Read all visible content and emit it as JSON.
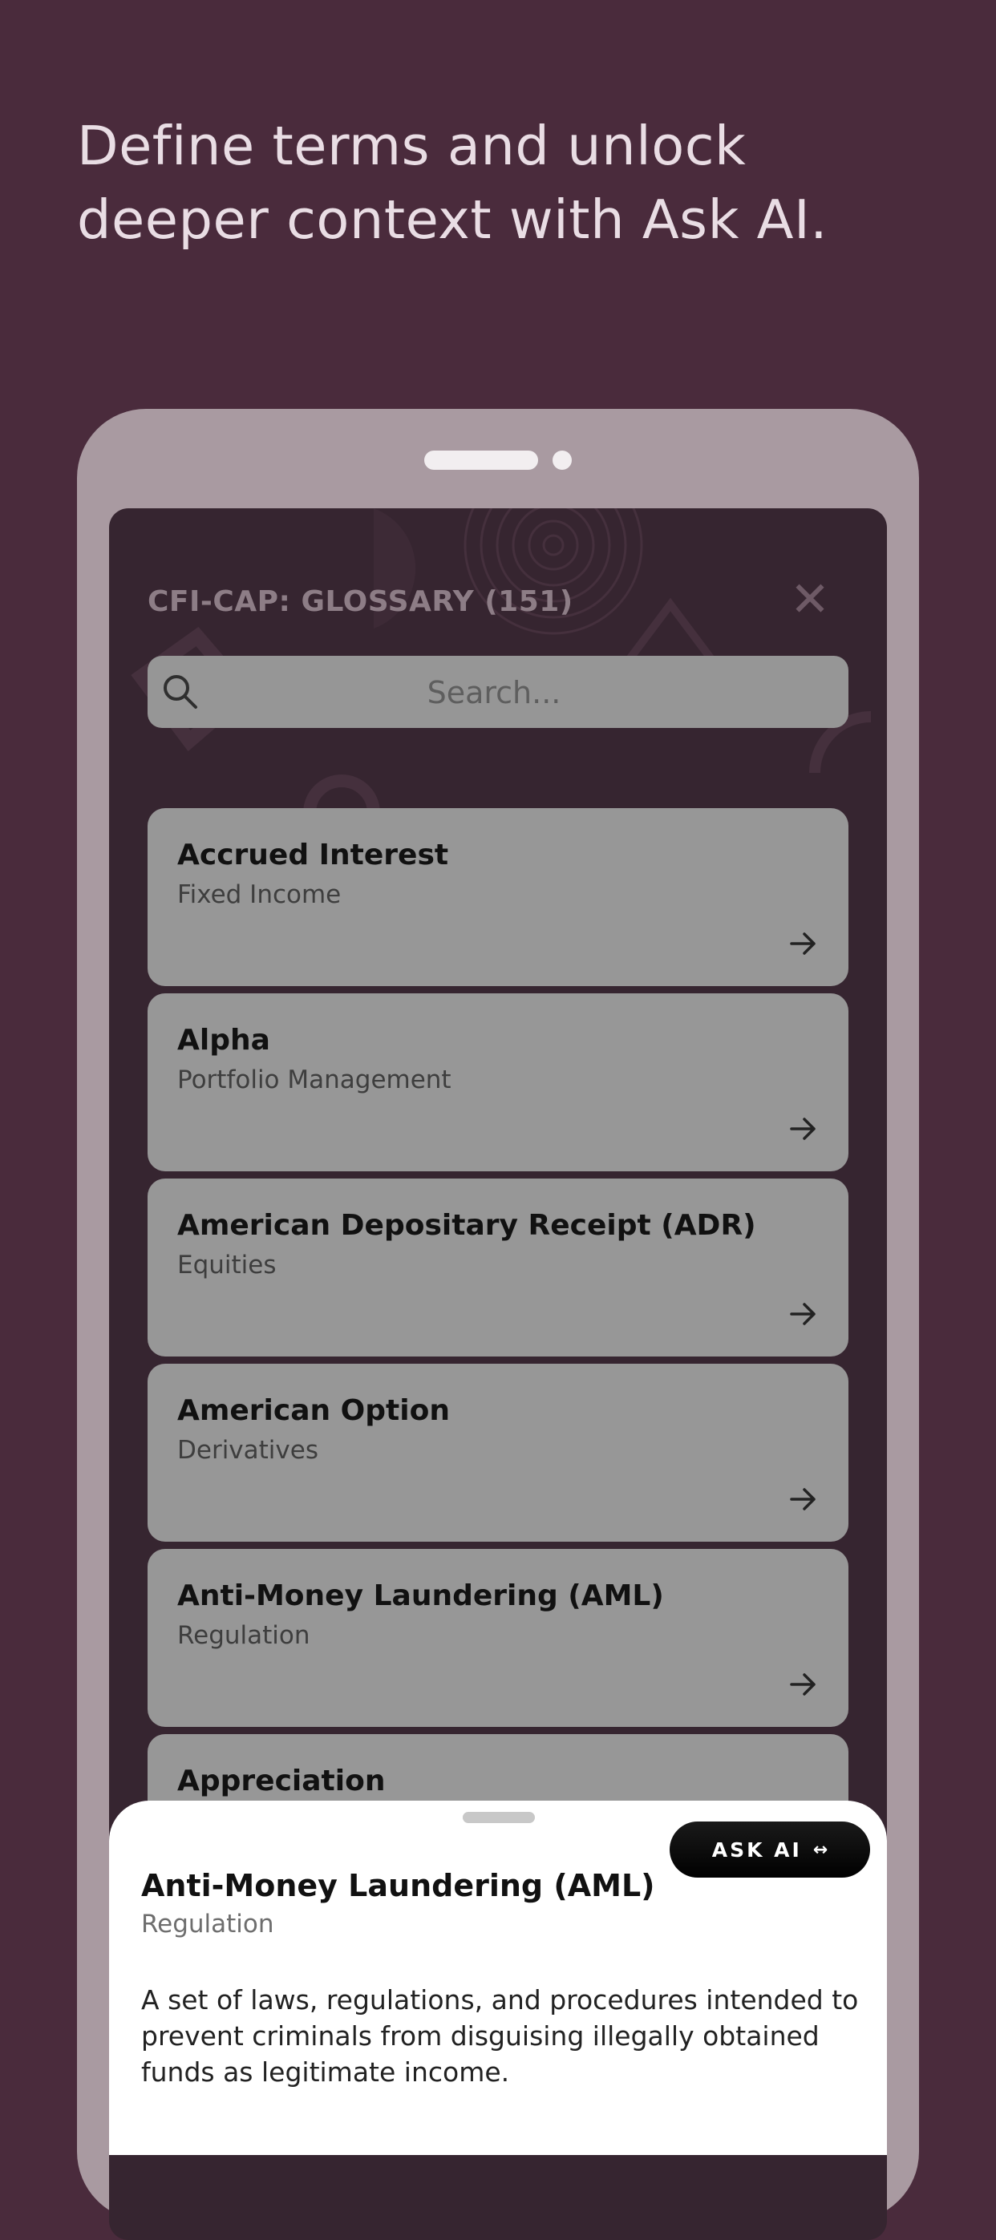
{
  "headline": {
    "line1": "Define terms and unlock",
    "line2": "deeper context with Ask AI."
  },
  "screen": {
    "title": "CFI-CAP: GLOSSARY (151)",
    "close_icon": "close-icon",
    "search": {
      "placeholder": "Search...",
      "icon": "search-icon"
    }
  },
  "terms": [
    {
      "title": "Accrued Interest",
      "category": "Fixed Income"
    },
    {
      "title": "Alpha",
      "category": "Portfolio Management"
    },
    {
      "title": "American Depositary Receipt (ADR)",
      "category": "Equities"
    },
    {
      "title": "American Option",
      "category": "Derivatives"
    },
    {
      "title": "Anti-Money Laundering (AML)",
      "category": "Regulation"
    },
    {
      "title": "Appreciation",
      "category": ""
    }
  ],
  "sheet": {
    "ask_ai_label": "ASK AI",
    "ask_ai_icon": "expand-arrows-icon",
    "title": "Anti-Money Laundering (AML)",
    "category": "Regulation",
    "description": "A set of laws, regulations, and procedures intended to prevent criminals from disguising illegally obtained funds as legitimate income."
  },
  "colors": {
    "background": "#4a2b3c",
    "phone_frame": "#a99aa1",
    "screen": "#362530",
    "card": "#979797",
    "sheet": "#ffffff",
    "ask_ai_button": "#000000"
  }
}
